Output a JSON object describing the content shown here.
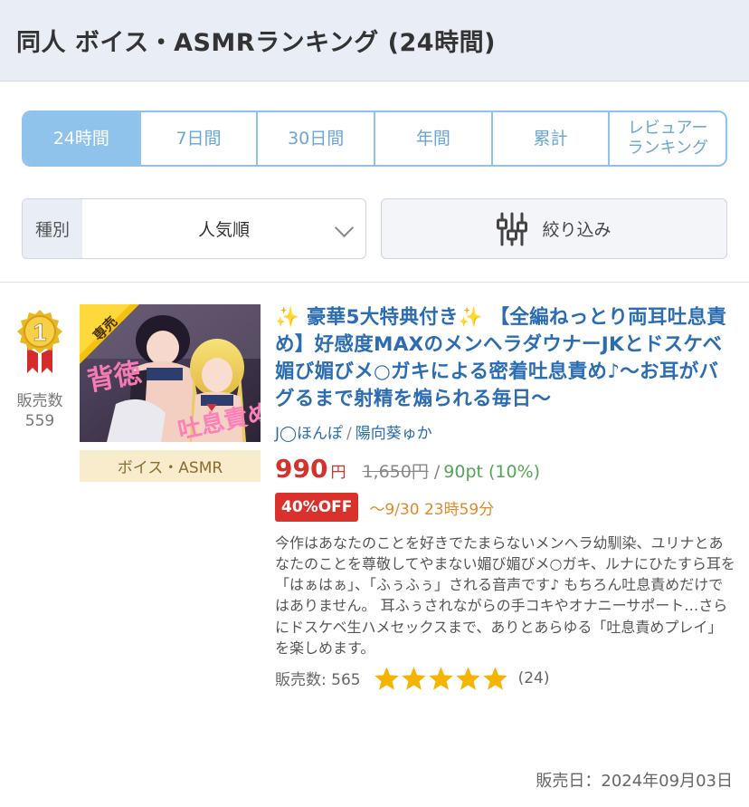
{
  "header": {
    "title": "同人 ボイス・ASMRランキング (24時間)"
  },
  "tabs": [
    {
      "label": "24時間",
      "active": true
    },
    {
      "label": "7日間"
    },
    {
      "label": "30日間"
    },
    {
      "label": "年間"
    },
    {
      "label": "累計"
    },
    {
      "label": "レビュアー\nランキング"
    }
  ],
  "sort": {
    "label": "種別",
    "value": "人気順"
  },
  "filter": {
    "label": "絞り込み"
  },
  "item": {
    "rank": "1",
    "sales_label": "販売数",
    "sales_count": "559",
    "thumb_badge": "専売",
    "category": "ボイス・ASMR",
    "title": "✨ 豪華5大特典付き✨ 【全編ねっとり両耳吐息責め】好感度MAXのメンヘラダウナーJKとドスケベ媚び媚びメ○ガキによる密着吐息責め♪〜お耳がバグるまで射精を煽られる毎日〜",
    "circle": "J◯ほんぽ",
    "voice_actor": "陽向葵ゅか",
    "price": "990",
    "yen": "円",
    "original_price": "1,650円",
    "points": "90pt (10%)",
    "discount": "40%OFF",
    "deadline": "〜9/30 23時59分",
    "description": "今作はあなたのことを好きでたまらないメンヘラ幼馴染、ユリナとあなたのことを尊敬してやまない媚び媚びメ○ガキ、ルナにひたすら耳を「はぁはぁ」、「ふぅふぅ」される音声です♪ もちろん吐息責めだけではありません。 耳ふぅされながらの手コキやオナニーサポート…さらにドスケベ生ハメセックスまで、ありとあらゆる「吐息責めプレイ」を楽しめます。",
    "sales_meta": "販売数: 565",
    "rating": 5,
    "review_count": "(24)",
    "release_date": "販売日：2024年09月03日"
  },
  "colors": {
    "accent": "#8fc3ec",
    "title": "#2b6cb3",
    "price": "#d4322a",
    "points": "#56a357",
    "star": "#f5b400"
  }
}
